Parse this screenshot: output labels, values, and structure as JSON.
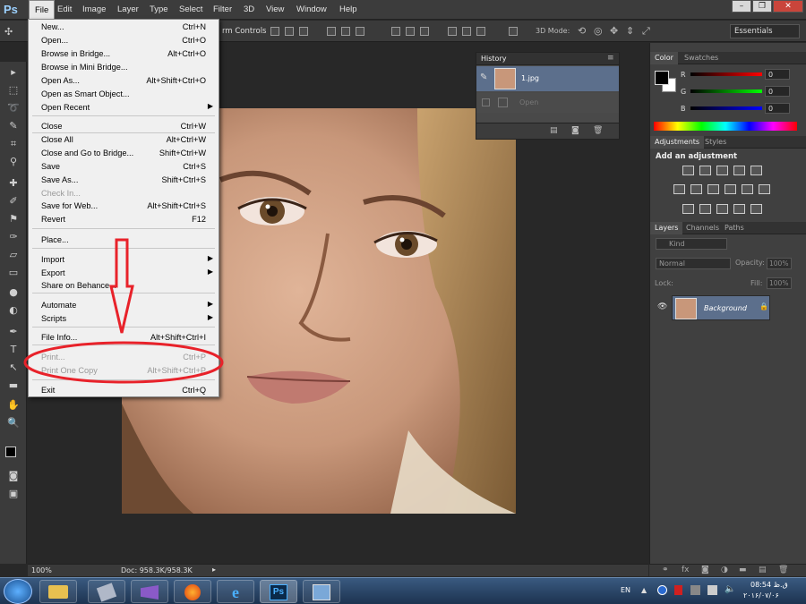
{
  "app": {
    "logo": "Ps"
  },
  "menubar": {
    "items": [
      "File",
      "Edit",
      "Image",
      "Layer",
      "Type",
      "Select",
      "Filter",
      "3D",
      "View",
      "Window",
      "Help"
    ],
    "window_buttons": [
      "–",
      "❐",
      "✕"
    ]
  },
  "options": {
    "transform_label": "rm Controls",
    "mode_label": "3D Mode:",
    "workspace": "Essentials"
  },
  "file_menu": {
    "items": [
      {
        "label": "New...",
        "shortcut": "Ctrl+N"
      },
      {
        "label": "Open...",
        "shortcut": "Ctrl+O"
      },
      {
        "label": "Browse in Bridge...",
        "shortcut": "Alt+Ctrl+O"
      },
      {
        "label": "Browse in Mini Bridge...",
        "shortcut": ""
      },
      {
        "label": "Open As...",
        "shortcut": "Alt+Shift+Ctrl+O"
      },
      {
        "label": "Open as Smart Object...",
        "shortcut": ""
      },
      {
        "label": "Open Recent",
        "shortcut": ""
      },
      {
        "label": "Close",
        "shortcut": "Ctrl+W"
      },
      {
        "label": "Close All",
        "shortcut": "Alt+Ctrl+W"
      },
      {
        "label": "Close and Go to Bridge...",
        "shortcut": "Shift+Ctrl+W"
      },
      {
        "label": "Save",
        "shortcut": "Ctrl+S"
      },
      {
        "label": "Save As...",
        "shortcut": "Shift+Ctrl+S"
      },
      {
        "label": "Check In...",
        "shortcut": ""
      },
      {
        "label": "Save for Web...",
        "shortcut": "Alt+Shift+Ctrl+S"
      },
      {
        "label": "Revert",
        "shortcut": "F12"
      },
      {
        "label": "Place...",
        "shortcut": ""
      },
      {
        "label": "Import",
        "shortcut": ""
      },
      {
        "label": "Export",
        "shortcut": ""
      },
      {
        "label": "Share on Behance...",
        "shortcut": ""
      },
      {
        "label": "Automate",
        "shortcut": ""
      },
      {
        "label": "Scripts",
        "shortcut": ""
      },
      {
        "label": "File Info...",
        "shortcut": "Alt+Shift+Ctrl+I"
      },
      {
        "label": "Print...",
        "shortcut": "Ctrl+P"
      },
      {
        "label": "Print One Copy",
        "shortcut": "Alt+Shift+Ctrl+P"
      },
      {
        "label": "Exit",
        "shortcut": "Ctrl+Q"
      }
    ]
  },
  "history": {
    "title": "History",
    "snapshot": "1.jpg",
    "step": "Open"
  },
  "color_panel": {
    "tabs": [
      "Color",
      "Swatches"
    ],
    "channels": [
      {
        "name": "R",
        "value": "0"
      },
      {
        "name": "G",
        "value": "0"
      },
      {
        "name": "B",
        "value": "0"
      }
    ]
  },
  "adjustments": {
    "tabs": [
      "Adjustments",
      "Styles"
    ],
    "heading": "Add an adjustment"
  },
  "layers": {
    "tabs": [
      "Layers",
      "Channels",
      "Paths"
    ],
    "kind": "Kind",
    "blend": "Normal",
    "opacity_label": "Opacity:",
    "opacity": "100%",
    "lock_label": "Lock:",
    "fill_label": "Fill:",
    "fill": "100%",
    "layer_name": "Background"
  },
  "status": {
    "zoom": "100%",
    "doc": "Doc: 958.3K/958.3K"
  },
  "taskbar": {
    "lang": "EN",
    "time": "08:54 ق.ظ",
    "date": "۲۰۱۶/۰۷/۰۶"
  },
  "colors": {
    "accent": "#e8222a",
    "menu_bg": "#f0f0f0",
    "panel": "#404040"
  }
}
